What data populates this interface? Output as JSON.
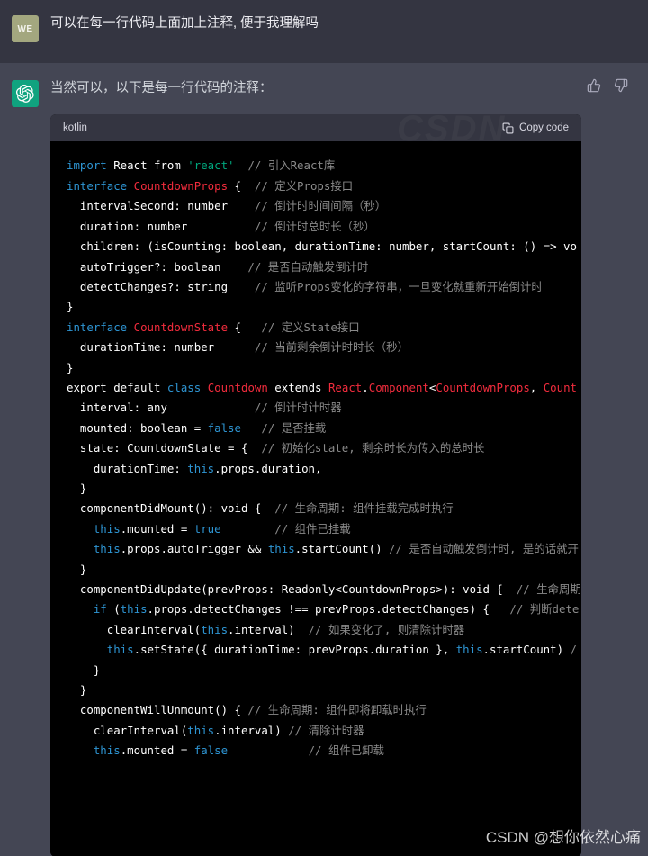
{
  "conversation": {
    "user_message": {
      "avatar_initials": "WE",
      "text": "可以在每一行代码上面加上注释, 便于我理解吗"
    },
    "assistant_message": {
      "avatar_icon": "openai-logo-icon",
      "text": "当然可以，以下是每一行代码的注释：",
      "feedback": {
        "thumbs_up": "thumbs-up-icon",
        "thumbs_down": "thumbs-down-icon"
      }
    }
  },
  "code_block": {
    "language": "kotlin",
    "copy_label": "Copy code",
    "header_watermark": "CSDN",
    "lines": [
      {
        "indent": 0,
        "tokens": [
          {
            "t": "import",
            "c": "kw"
          },
          {
            "t": " React from ",
            "c": "pl"
          },
          {
            "t": "'react'",
            "c": "st"
          },
          {
            "t": "  ",
            "c": "pl"
          },
          {
            "t": "// 引入React库",
            "c": "cm"
          }
        ]
      },
      {
        "indent": 0,
        "tokens": [
          {
            "t": "",
            "c": "pl"
          }
        ]
      },
      {
        "indent": 0,
        "tokens": [
          {
            "t": "interface",
            "c": "kw"
          },
          {
            "t": " ",
            "c": "pl"
          },
          {
            "t": "CountdownProps",
            "c": "ty"
          },
          {
            "t": " {  ",
            "c": "pl"
          },
          {
            "t": "// 定义Props接口",
            "c": "cm"
          }
        ]
      },
      {
        "indent": 1,
        "tokens": [
          {
            "t": "intervalSecond: number    ",
            "c": "pl"
          },
          {
            "t": "// 倒计时时间间隔（秒）",
            "c": "cm"
          }
        ]
      },
      {
        "indent": 1,
        "tokens": [
          {
            "t": "duration: number          ",
            "c": "pl"
          },
          {
            "t": "// 倒计时总时长（秒）",
            "c": "cm"
          }
        ]
      },
      {
        "indent": 1,
        "tokens": [
          {
            "t": "children: (isCounting: boolean, durationTime: number, startCount: () => vo",
            "c": "pl"
          }
        ]
      },
      {
        "indent": 1,
        "tokens": [
          {
            "t": "autoTrigger?: boolean    ",
            "c": "pl"
          },
          {
            "t": "// 是否自动触发倒计时",
            "c": "cm"
          }
        ]
      },
      {
        "indent": 1,
        "tokens": [
          {
            "t": "detectChanges?: string    ",
            "c": "pl"
          },
          {
            "t": "// 监听Props变化的字符串，一旦变化就重新开始倒计时",
            "c": "cm"
          }
        ]
      },
      {
        "indent": 0,
        "tokens": [
          {
            "t": "}",
            "c": "pl"
          }
        ]
      },
      {
        "indent": 0,
        "tokens": [
          {
            "t": "",
            "c": "pl"
          }
        ]
      },
      {
        "indent": 0,
        "tokens": [
          {
            "t": "interface",
            "c": "kw"
          },
          {
            "t": " ",
            "c": "pl"
          },
          {
            "t": "CountdownState",
            "c": "ty"
          },
          {
            "t": " {   ",
            "c": "pl"
          },
          {
            "t": "// 定义State接口",
            "c": "cm"
          }
        ]
      },
      {
        "indent": 1,
        "tokens": [
          {
            "t": "durationTime: number      ",
            "c": "pl"
          },
          {
            "t": "// 当前剩余倒计时时长（秒）",
            "c": "cm"
          }
        ]
      },
      {
        "indent": 0,
        "tokens": [
          {
            "t": "}",
            "c": "pl"
          }
        ]
      },
      {
        "indent": 0,
        "tokens": [
          {
            "t": "",
            "c": "pl"
          }
        ]
      },
      {
        "indent": 0,
        "tokens": [
          {
            "t": "export default ",
            "c": "pl"
          },
          {
            "t": "class",
            "c": "kw"
          },
          {
            "t": " ",
            "c": "pl"
          },
          {
            "t": "Countdown",
            "c": "ty"
          },
          {
            "t": " extends ",
            "c": "pl"
          },
          {
            "t": "React",
            "c": "ty"
          },
          {
            "t": ".",
            "c": "pl"
          },
          {
            "t": "Component",
            "c": "ty"
          },
          {
            "t": "<",
            "c": "pl"
          },
          {
            "t": "CountdownProps",
            "c": "ty"
          },
          {
            "t": ", ",
            "c": "pl"
          },
          {
            "t": "Count",
            "c": "ty"
          }
        ]
      },
      {
        "indent": 1,
        "tokens": [
          {
            "t": "interval: any             ",
            "c": "pl"
          },
          {
            "t": "// 倒计时计时器",
            "c": "cm"
          }
        ]
      },
      {
        "indent": 1,
        "tokens": [
          {
            "t": "mounted: boolean = ",
            "c": "pl"
          },
          {
            "t": "false",
            "c": "bl"
          },
          {
            "t": "   ",
            "c": "pl"
          },
          {
            "t": "// 是否挂载",
            "c": "cm"
          }
        ]
      },
      {
        "indent": 1,
        "tokens": [
          {
            "t": "state: CountdownState = {  ",
            "c": "pl"
          },
          {
            "t": "// 初始化state, 剩余时长为传入的总时长",
            "c": "cm"
          }
        ]
      },
      {
        "indent": 2,
        "tokens": [
          {
            "t": "durationTime: ",
            "c": "pl"
          },
          {
            "t": "this",
            "c": "bl"
          },
          {
            "t": ".props.duration,",
            "c": "pl"
          }
        ]
      },
      {
        "indent": 1,
        "tokens": [
          {
            "t": "}",
            "c": "pl"
          }
        ]
      },
      {
        "indent": 0,
        "tokens": [
          {
            "t": "",
            "c": "pl"
          }
        ]
      },
      {
        "indent": 1,
        "tokens": [
          {
            "t": "componentDidMount(): void {  ",
            "c": "pl"
          },
          {
            "t": "// 生命周期: 组件挂载完成时执行",
            "c": "cm"
          }
        ]
      },
      {
        "indent": 2,
        "tokens": [
          {
            "t": "this",
            "c": "bl"
          },
          {
            "t": ".mounted = ",
            "c": "pl"
          },
          {
            "t": "true",
            "c": "bl"
          },
          {
            "t": "        ",
            "c": "pl"
          },
          {
            "t": "// 组件已挂载",
            "c": "cm"
          }
        ]
      },
      {
        "indent": 2,
        "tokens": [
          {
            "t": "this",
            "c": "bl"
          },
          {
            "t": ".props.autoTrigger && ",
            "c": "pl"
          },
          {
            "t": "this",
            "c": "bl"
          },
          {
            "t": ".startCount() ",
            "c": "pl"
          },
          {
            "t": "// 是否自动触发倒计时, 是的话就开",
            "c": "cm"
          }
        ]
      },
      {
        "indent": 1,
        "tokens": [
          {
            "t": "}",
            "c": "pl"
          }
        ]
      },
      {
        "indent": 0,
        "tokens": [
          {
            "t": "",
            "c": "pl"
          }
        ]
      },
      {
        "indent": 1,
        "tokens": [
          {
            "t": "componentDidUpdate(prevProps: Readonly<CountdownProps>): void {  ",
            "c": "pl"
          },
          {
            "t": "// 生命周期",
            "c": "cm"
          }
        ]
      },
      {
        "indent": 2,
        "tokens": [
          {
            "t": "if",
            "c": "bl"
          },
          {
            "t": " (",
            "c": "pl"
          },
          {
            "t": "this",
            "c": "bl"
          },
          {
            "t": ".props.detectChanges !== prevProps.detectChanges) {   ",
            "c": "pl"
          },
          {
            "t": "// 判断dete",
            "c": "cm"
          }
        ]
      },
      {
        "indent": 3,
        "tokens": [
          {
            "t": "clearInterval(",
            "c": "pl"
          },
          {
            "t": "this",
            "c": "bl"
          },
          {
            "t": ".interval)  ",
            "c": "pl"
          },
          {
            "t": "// 如果变化了, 则清除计时器",
            "c": "cm"
          }
        ]
      },
      {
        "indent": 3,
        "tokens": [
          {
            "t": "this",
            "c": "bl"
          },
          {
            "t": ".setState({ durationTime: prevProps.duration }, ",
            "c": "pl"
          },
          {
            "t": "this",
            "c": "bl"
          },
          {
            "t": ".startCount) ",
            "c": "pl"
          },
          {
            "t": "/",
            "c": "cm"
          }
        ]
      },
      {
        "indent": 2,
        "tokens": [
          {
            "t": "}",
            "c": "pl"
          }
        ]
      },
      {
        "indent": 1,
        "tokens": [
          {
            "t": "}",
            "c": "pl"
          }
        ]
      },
      {
        "indent": 0,
        "tokens": [
          {
            "t": "",
            "c": "pl"
          }
        ]
      },
      {
        "indent": 1,
        "tokens": [
          {
            "t": "componentWillUnmount() { ",
            "c": "pl"
          },
          {
            "t": "// 生命周期: 组件即将卸载时执行",
            "c": "cm"
          }
        ]
      },
      {
        "indent": 2,
        "tokens": [
          {
            "t": "clearInterval(",
            "c": "pl"
          },
          {
            "t": "this",
            "c": "bl"
          },
          {
            "t": ".interval) ",
            "c": "pl"
          },
          {
            "t": "// 清除计时器",
            "c": "cm"
          }
        ]
      },
      {
        "indent": 2,
        "tokens": [
          {
            "t": "this",
            "c": "bl"
          },
          {
            "t": ".mounted = ",
            "c": "pl"
          },
          {
            "t": "false",
            "c": "bl"
          },
          {
            "t": "            ",
            "c": "pl"
          },
          {
            "t": "// 组件已卸载",
            "c": "cm"
          }
        ]
      }
    ]
  },
  "watermark": {
    "text": "CSDN @想你依然心痛"
  }
}
